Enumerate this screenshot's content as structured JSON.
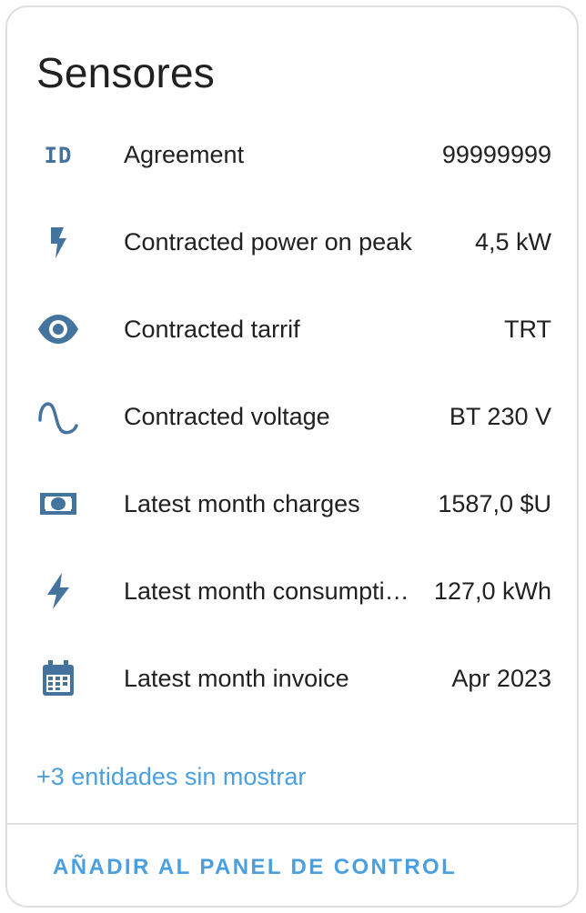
{
  "card": {
    "title": "Sensores"
  },
  "icon_color": "#44739e",
  "accent_color": "#4a9fe0",
  "rows": [
    {
      "icon": "id-icon",
      "label": "Agreement",
      "value": "99999999"
    },
    {
      "icon": "flash-icon",
      "label": "Contracted power on peak",
      "value": "4,5 kW"
    },
    {
      "icon": "eye-icon",
      "label": "Contracted tarrif",
      "value": "TRT"
    },
    {
      "icon": "sine-wave-icon",
      "label": "Contracted voltage",
      "value": "BT 230 V"
    },
    {
      "icon": "cash-icon",
      "label": "Latest month charges",
      "value": "1587,0 $U"
    },
    {
      "icon": "lightning-bolt-icon",
      "label": "Latest month consumpti…",
      "value": "127,0 kWh"
    },
    {
      "icon": "calendar-icon",
      "label": "Latest month invoice",
      "value": "Apr 2023"
    }
  ],
  "more_entities_text": "+3 entidades sin mostrar",
  "add_to_dashboard_label": "AÑADIR AL PANEL DE CONTROL"
}
